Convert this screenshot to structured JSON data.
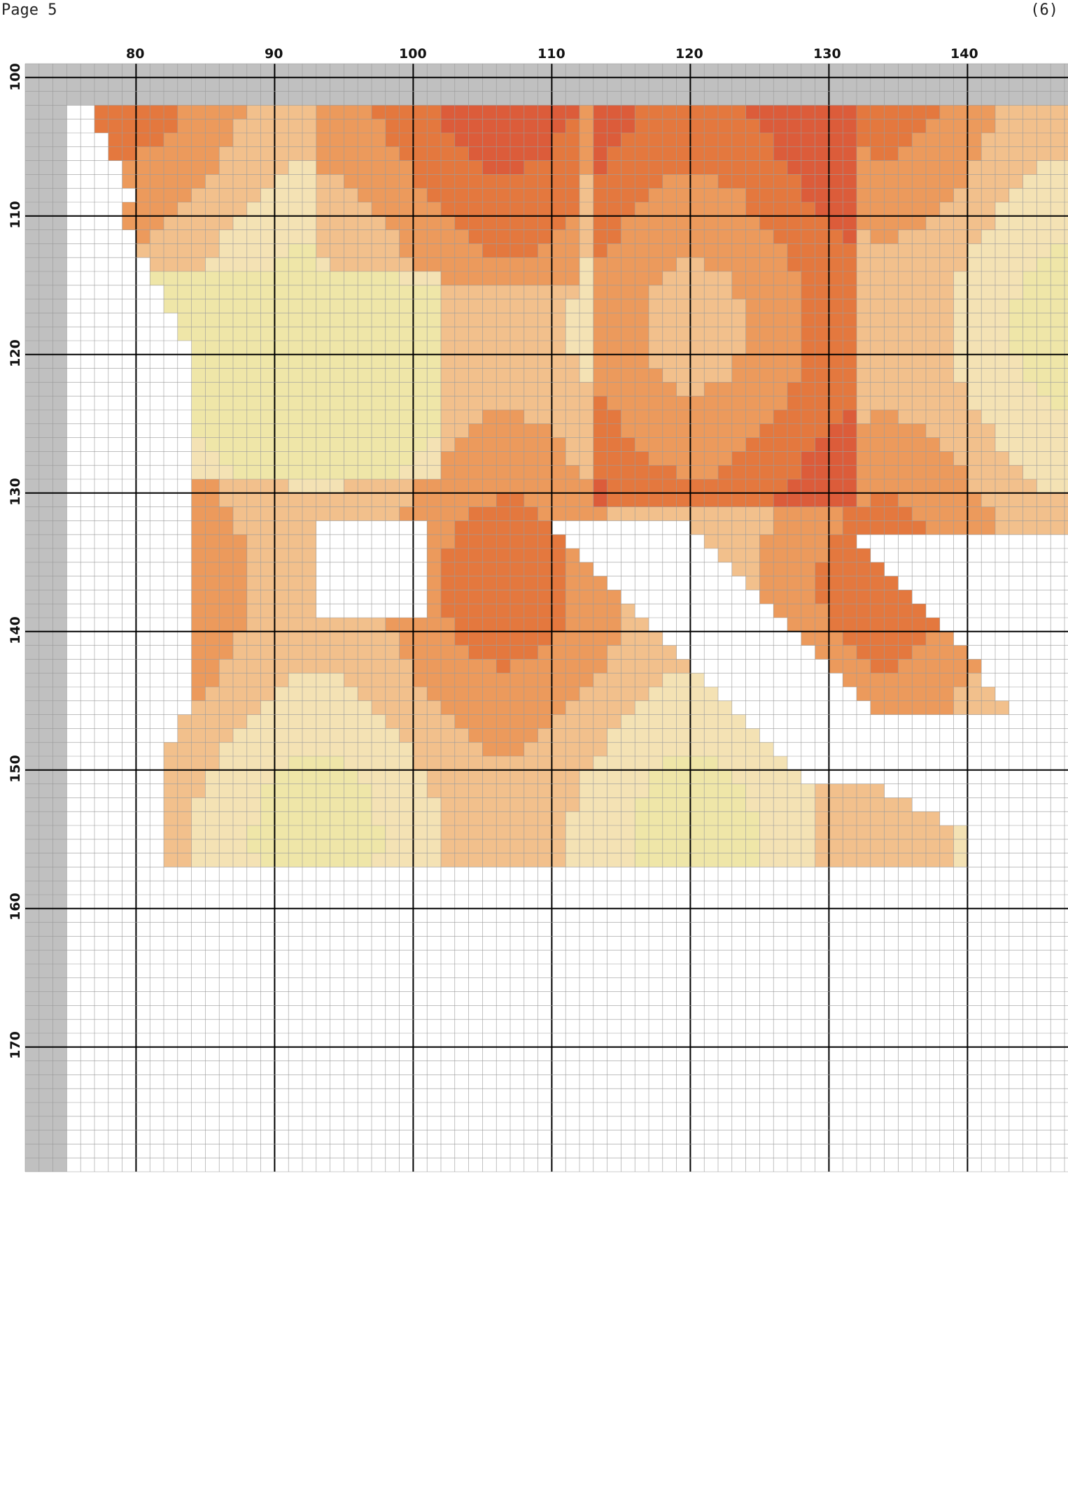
{
  "page": {
    "label": "Page 5",
    "number": "(6)"
  },
  "chart": {
    "column_labels": [
      "80",
      "90",
      "100",
      "110",
      "120",
      "130",
      "140"
    ],
    "row_labels": [
      "100",
      "110",
      "120",
      "130",
      "140",
      "150",
      "160",
      "170"
    ],
    "palette": {
      "light_yellow": "#efe6a8",
      "cream": "#f4e2b4",
      "peach": "#f2c08c",
      "orange": "#ec9a5c",
      "dark_orange": "#e4783e",
      "red_orange": "#dc5c3a",
      "grey_overlap": "#c0c0c0",
      "grid_line": "#9a9a9a",
      "major_line": "#000000"
    }
  }
}
